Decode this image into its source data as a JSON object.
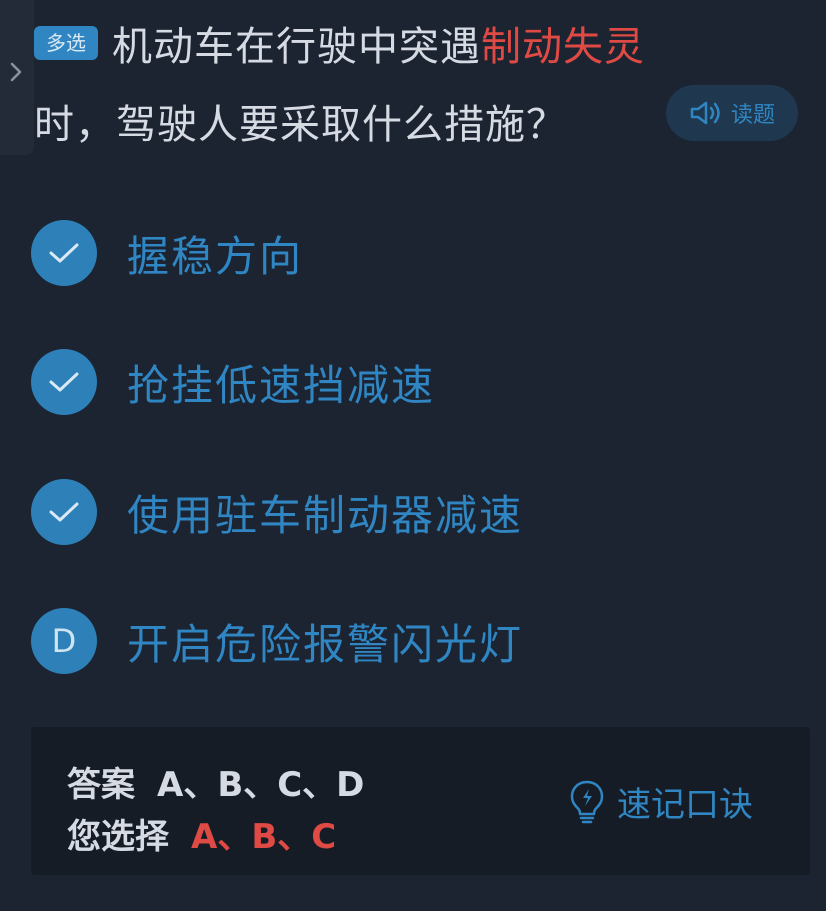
{
  "question": {
    "type_badge": "多选",
    "text_before": "机动车在行驶中突遇",
    "text_highlight": "制动失灵",
    "text_after": "时，驾驶人要采取什么措施？",
    "read_button_label": "读题"
  },
  "options": [
    {
      "marker": "check",
      "label": "握稳方向"
    },
    {
      "marker": "check",
      "label": "抢挂低速挡减速"
    },
    {
      "marker": "check",
      "label": "使用驻车制动器减速"
    },
    {
      "marker": "D",
      "label": "开启危险报警闪光灯"
    }
  ],
  "answer": {
    "correct_label": "答案",
    "correct_value": "A、B、C、D",
    "selected_label": "您选择",
    "selected_value": "A、B、C",
    "tips_label": "速记口诀"
  },
  "colors": {
    "background": "#1c2331",
    "accent": "#2f86c2",
    "highlight": "#e04a44",
    "answer_panel": "#161c26"
  }
}
